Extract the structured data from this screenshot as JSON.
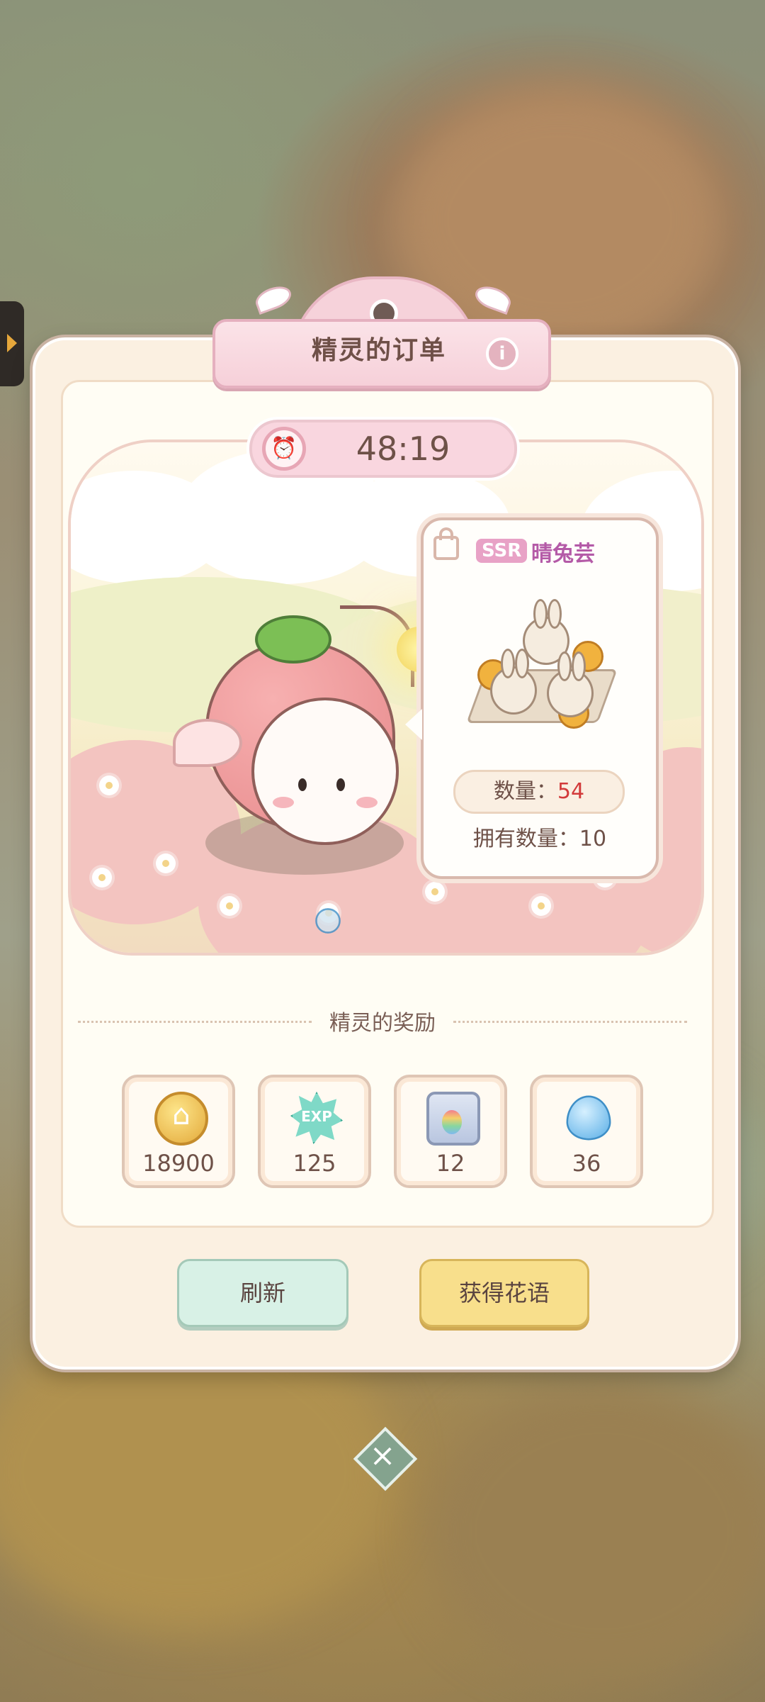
{
  "title": "精灵的订单",
  "timer": "48:19",
  "order": {
    "rarity": "SSR",
    "item_name": "晴兔芸",
    "quantity_label": "数量：",
    "quantity_value": "54",
    "owned_label": "拥有数量：10"
  },
  "reward_section_title": "精灵的奖励",
  "rewards": [
    {
      "icon": "coin-icon",
      "count": "18900"
    },
    {
      "icon": "exp-icon",
      "count": "125"
    },
    {
      "icon": "rainbow-bag-icon",
      "count": "12"
    },
    {
      "icon": "water-drop-icon",
      "count": "36"
    }
  ],
  "buttons": {
    "refresh": "刷新",
    "get_flower_words": "获得花语"
  },
  "colors": {
    "panel": "#fbf0e1",
    "title_plate": "#f6d2da",
    "quantity_highlight": "#d23a3a",
    "refresh_button": "#d8f1e6",
    "get_button": "#f8df8c"
  }
}
